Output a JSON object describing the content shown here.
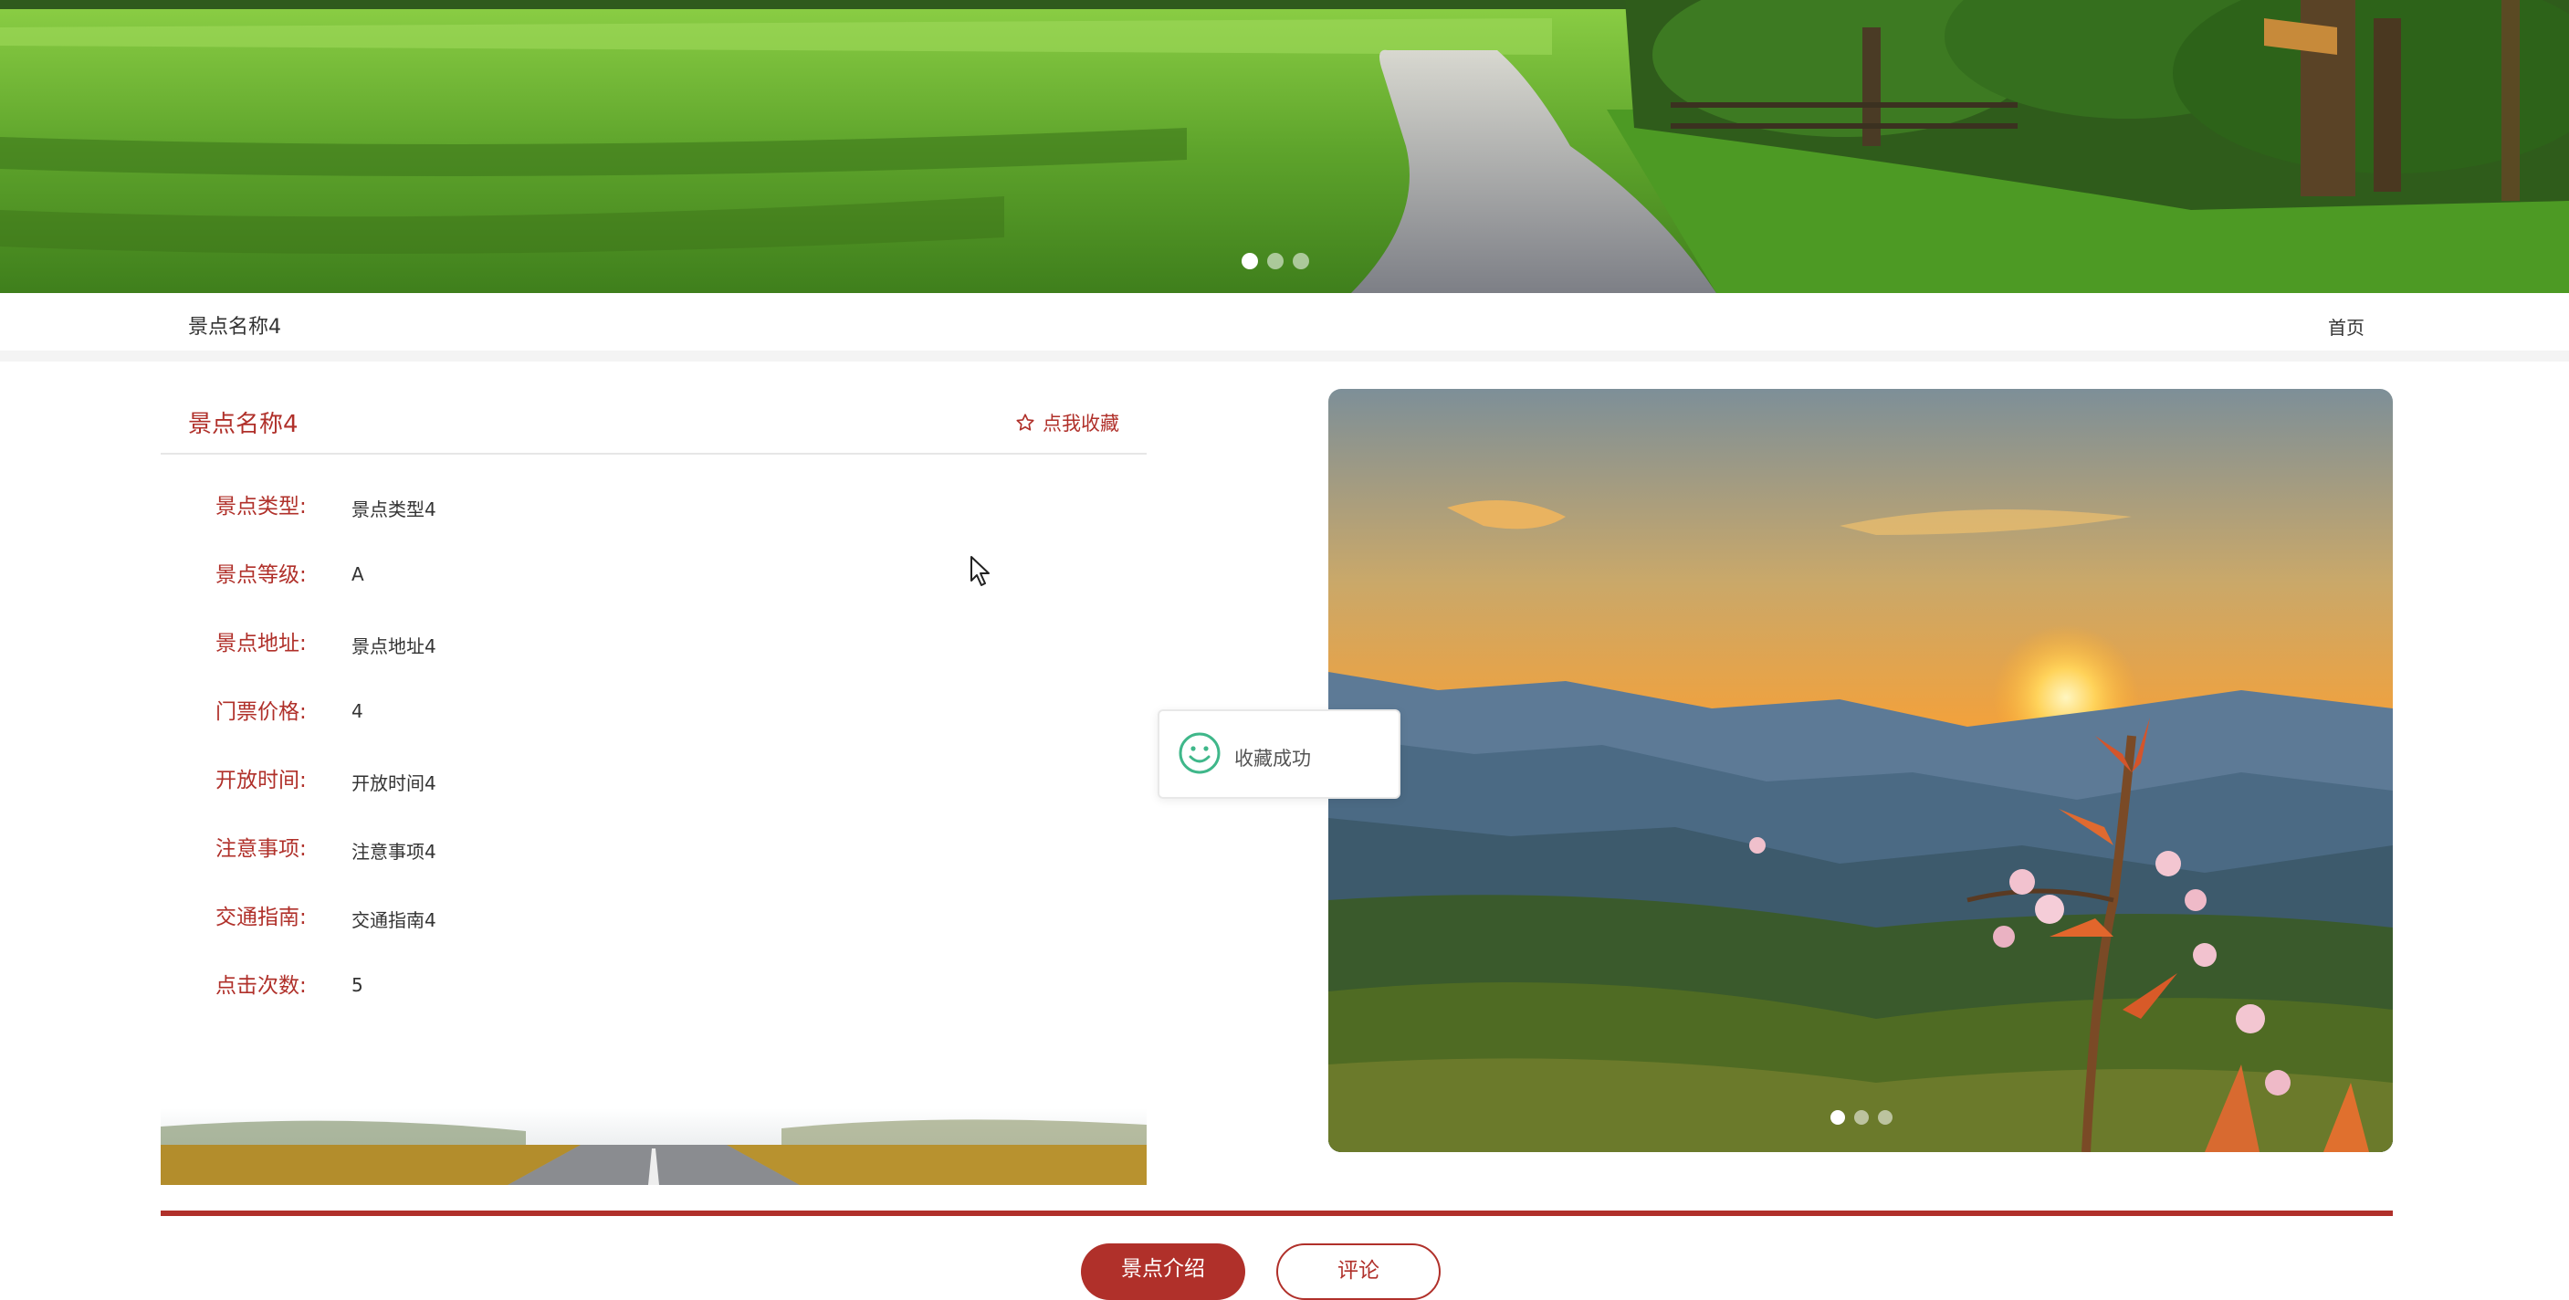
{
  "header": {
    "site_name": "景点名称4",
    "home_link": "首页"
  },
  "banner": {
    "slides": 3,
    "active_slide": 1
  },
  "detail": {
    "title": "景点名称4",
    "favorite_label": "点我收藏",
    "fields": [
      {
        "label": "景点类型:",
        "value": "景点类型4"
      },
      {
        "label": "景点等级:",
        "value": "A"
      },
      {
        "label": "景点地址:",
        "value": "景点地址4"
      },
      {
        "label": "门票价格:",
        "value": "4"
      },
      {
        "label": "开放时间:",
        "value": "开放时间4"
      },
      {
        "label": "注意事项:",
        "value": "注意事项4"
      },
      {
        "label": "交通指南:",
        "value": "交通指南4"
      },
      {
        "label": "点击次数:",
        "value": "5"
      }
    ]
  },
  "carousel": {
    "slides": 3,
    "active_slide": 1
  },
  "toast": {
    "message": "收藏成功",
    "icon": "smile-icon"
  },
  "tabs": {
    "intro_label": "景点介绍",
    "review_label": "评论"
  },
  "colors": {
    "accent": "#b0302a",
    "toast_icon": "#3fb78a"
  }
}
